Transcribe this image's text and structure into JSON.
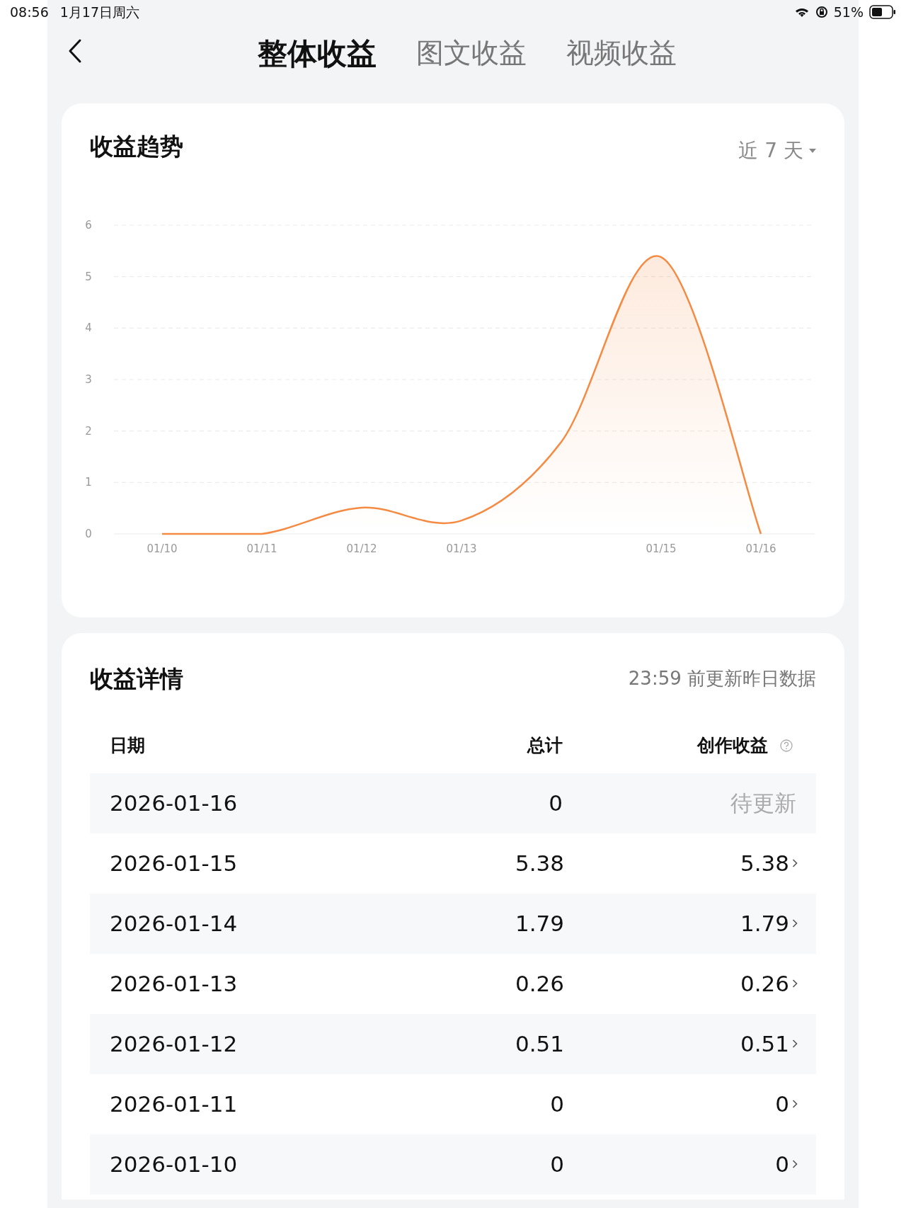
{
  "status_bar": {
    "time": "08:56",
    "date": "1月17日周六",
    "battery": "51%"
  },
  "tabs": [
    {
      "label": "整体收益",
      "selected": true
    },
    {
      "label": "图文收益",
      "selected": false
    },
    {
      "label": "视频收益",
      "selected": false
    }
  ],
  "trend": {
    "title": "收益趋势",
    "range": "近 7 天",
    "chart_data": {
      "type": "area",
      "categories": [
        "01/10",
        "01/11",
        "01/12",
        "01/13",
        null,
        "01/15",
        "01/16"
      ],
      "series": [
        {
          "color": "#f58a42",
          "values": [
            0,
            0,
            0.51,
            0.26,
            1.79,
            5.38,
            0
          ]
        }
      ],
      "ylim": [
        0,
        6
      ],
      "grid": true,
      "yticks": [
        0,
        1,
        2,
        3,
        4,
        5,
        6
      ]
    }
  },
  "details": {
    "title": "收益详情",
    "note": "23:59 前更新昨日数据",
    "columns": [
      "日期",
      "总计",
      "创作收益"
    ],
    "rows": [
      {
        "date": "2026-01-16",
        "total": "0",
        "creation": "待更新",
        "pending": true
      },
      {
        "date": "2026-01-15",
        "total": "5.38",
        "creation": "5.38",
        "pending": false
      },
      {
        "date": "2026-01-14",
        "total": "1.79",
        "creation": "1.79",
        "pending": false
      },
      {
        "date": "2026-01-13",
        "total": "0.26",
        "creation": "0.26",
        "pending": false
      },
      {
        "date": "2026-01-12",
        "total": "0.51",
        "creation": "0.51",
        "pending": false
      },
      {
        "date": "2026-01-11",
        "total": "0",
        "creation": "0",
        "pending": false
      },
      {
        "date": "2026-01-10",
        "total": "0",
        "creation": "0",
        "pending": false
      }
    ]
  }
}
